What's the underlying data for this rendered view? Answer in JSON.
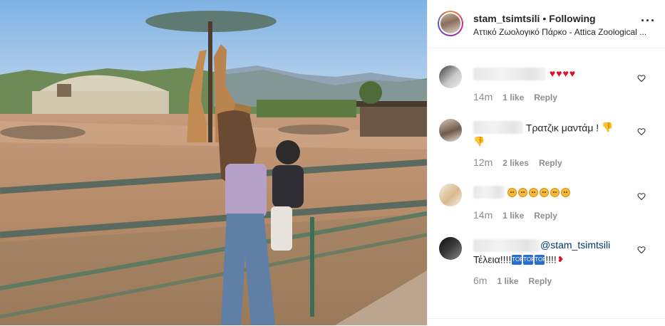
{
  "post": {
    "username": "stam_tsimtsili",
    "separator": "•",
    "follow_status": "Following",
    "location": "Αττικό Ζωολογικό Πάρκο - Attica Zoological ..."
  },
  "comments": [
    {
      "text": "",
      "emoji": [
        "red-heart",
        "red-heart",
        "red-heart",
        "red-heart"
      ],
      "time": "14m",
      "likes": "1 like",
      "reply": "Reply"
    },
    {
      "text": "Τρατζικ μαντάμ !",
      "emoji": [
        "thumbs-down",
        "thumbs-down"
      ],
      "time": "12m",
      "likes": "2 likes",
      "reply": "Reply"
    },
    {
      "text": "",
      "emoji": [
        "sad-face",
        "sad-face",
        "sad-face",
        "sad-face",
        "sad-face",
        "sad-face"
      ],
      "time": "14m",
      "likes": "1 like",
      "reply": "Reply"
    },
    {
      "mention": "@stam_tsimtsili",
      "text": "Τέλεια!!!!",
      "emoji": [
        "top-arrow",
        "top-arrow",
        "top-arrow"
      ],
      "text_after": "!!!!",
      "time": "6m",
      "likes": "1 like",
      "reply": "Reply"
    }
  ],
  "colors": {
    "link": "#003569",
    "muted": "#8e8e8e",
    "heart": "#e0112b"
  }
}
